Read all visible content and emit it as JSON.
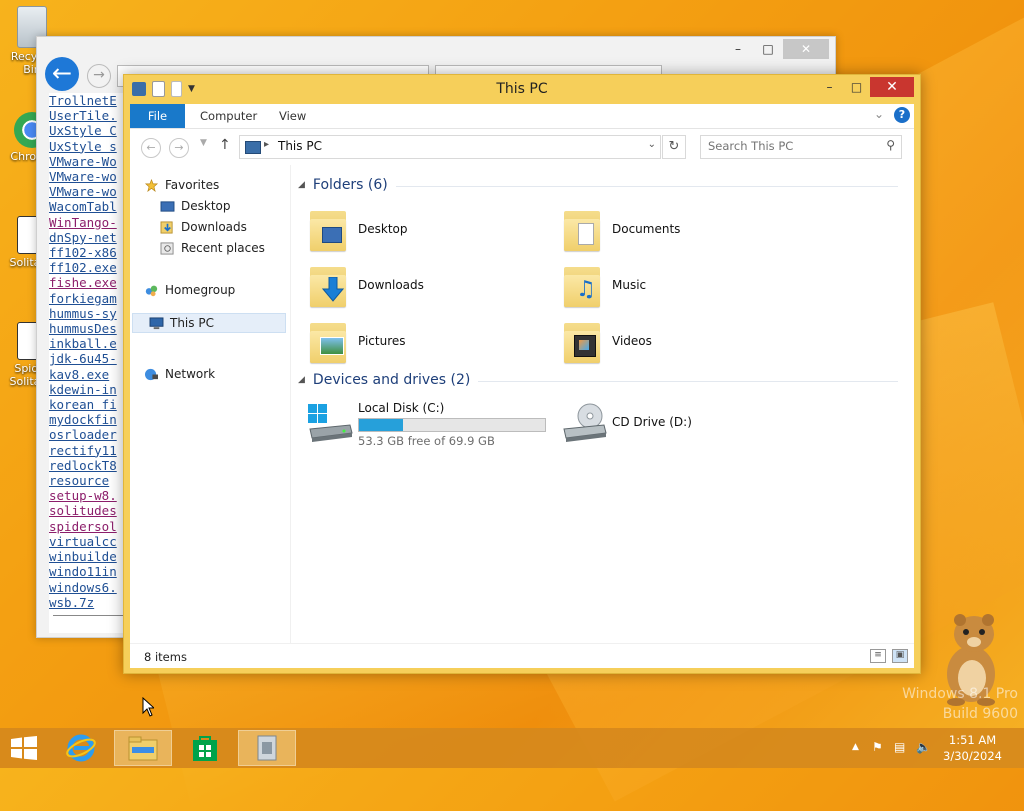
{
  "desktop": {
    "icons": [
      {
        "label": "Recycle Bin"
      },
      {
        "label": "Chrome"
      },
      {
        "label": "Solitaire"
      },
      {
        "label": "Spider Solitaire"
      }
    ],
    "watermark_line1": "Windows 8.1 Pro",
    "watermark_line2": "Build 9600"
  },
  "browser": {
    "links": [
      {
        "text": "TrollnetE",
        "visited": false
      },
      {
        "text": "UserTile.",
        "visited": false
      },
      {
        "text": "UxStyle C",
        "visited": false
      },
      {
        "text": "UxStyle s",
        "visited": false
      },
      {
        "text": "VMware-Wo",
        "visited": false
      },
      {
        "text": "VMware-wo",
        "visited": false
      },
      {
        "text": "VMware-wo",
        "visited": false
      },
      {
        "text": "WacomTabl",
        "visited": false
      },
      {
        "text": "WinTango-",
        "visited": true
      },
      {
        "text": "dnSpy-net",
        "visited": false
      },
      {
        "text": "ff102-x86",
        "visited": false
      },
      {
        "text": "ff102.exe",
        "visited": false
      },
      {
        "text": "fishe.exe",
        "visited": true
      },
      {
        "text": "forkiegam",
        "visited": false
      },
      {
        "text": "hummus-sy",
        "visited": false
      },
      {
        "text": "hummusDes",
        "visited": false
      },
      {
        "text": "inkball.e",
        "visited": false
      },
      {
        "text": "jdk-6u45-",
        "visited": false
      },
      {
        "text": "kav8.exe",
        "visited": false
      },
      {
        "text": "kdewin-in",
        "visited": false
      },
      {
        "text": "korean fi",
        "visited": false
      },
      {
        "text": "mydockfin",
        "visited": false
      },
      {
        "text": "osrloader",
        "visited": false
      },
      {
        "text": "rectify11",
        "visited": false
      },
      {
        "text": "redlockT8",
        "visited": false
      },
      {
        "text": "resource ",
        "visited": false
      },
      {
        "text": "setup-w8.",
        "visited": true
      },
      {
        "text": "solitudes",
        "visited": true
      },
      {
        "text": "spidersol",
        "visited": true
      },
      {
        "text": "virtualcc",
        "visited": false
      },
      {
        "text": "winbuilde",
        "visited": false
      },
      {
        "text": "windo11in",
        "visited": false
      },
      {
        "text": "windows6.",
        "visited": false
      },
      {
        "text": "wsb.7z",
        "visited": false
      }
    ]
  },
  "explorer": {
    "title": "This PC",
    "ribbon_tabs": {
      "file": "File",
      "computer": "Computer",
      "view": "View"
    },
    "address": "This PC",
    "search_placeholder": "Search This PC",
    "nav": {
      "favorites": "Favorites",
      "desktop": "Desktop",
      "downloads": "Downloads",
      "recent": "Recent places",
      "homegroup": "Homegroup",
      "thispc": "This PC",
      "network": "Network"
    },
    "folders_header": "Folders (6)",
    "folders": [
      {
        "name": "Desktop",
        "icon": "desktop-folder-icon"
      },
      {
        "name": "Documents",
        "icon": "documents-folder-icon"
      },
      {
        "name": "Downloads",
        "icon": "downloads-folder-icon"
      },
      {
        "name": "Music",
        "icon": "music-folder-icon"
      },
      {
        "name": "Pictures",
        "icon": "pictures-folder-icon"
      },
      {
        "name": "Videos",
        "icon": "videos-folder-icon"
      }
    ],
    "devices_header": "Devices and drives (2)",
    "drives": {
      "c_name": "Local Disk (C:)",
      "c_free": "53.3 GB free of 69.9 GB",
      "c_used_fraction": 0.2375,
      "d_name": "CD Drive (D:)"
    },
    "status": "8 items"
  },
  "taskbar": {
    "time": "1:51 AM",
    "date": "3/30/2024"
  },
  "colors": {
    "accent": "#1979ca",
    "frame": "#f6cf5a",
    "close": "#c9362f",
    "drive_fill": "#26a0da"
  }
}
